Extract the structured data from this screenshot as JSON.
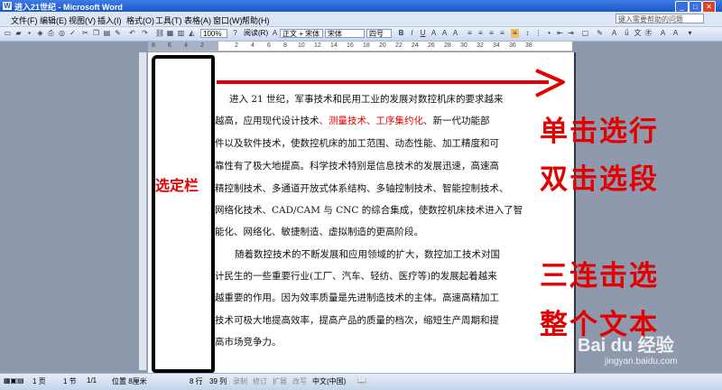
{
  "window": {
    "title": "进入21世纪 - Microsoft Word",
    "min": "_",
    "max": "□",
    "close": "✕"
  },
  "menu": {
    "items": [
      "文件(F)",
      "编辑(E)",
      "视图(V)",
      "插入(I)",
      "格式(O)",
      "工具(T)",
      "表格(A)",
      "窗口(W)",
      "帮助(H)"
    ],
    "help_placeholder": "键入需要帮助的问题"
  },
  "toolbar": {
    "zoom": "100%",
    "read_mode": "阅读(R)",
    "style": "正文 + 宋体",
    "font": "宋体",
    "size": "四号",
    "bold": "B",
    "italic": "I",
    "underline": "U"
  },
  "ruler": {
    "ticks": [
      "8",
      "6",
      "4",
      "2",
      "2",
      "4",
      "6",
      "8",
      "10",
      "12",
      "14",
      "16",
      "18",
      "20",
      "22",
      "24",
      "26",
      "28",
      "30",
      "32",
      "34",
      "36",
      "38"
    ]
  },
  "document": {
    "lines": [
      {
        "pre": "进入 21 世纪，军事技术和民用工业的发展对数控机床的要求越来",
        "red": "",
        "post": ""
      },
      {
        "pre": "越高，应用现代设计技术",
        "red": "、测量技术、工序集约化",
        "post": "、新一代功能部"
      },
      {
        "pre": "件以及软件技术，使数控机床的加工范围、动态性能、加工精度和可",
        "red": "",
        "post": ""
      },
      {
        "pre": "靠性有了极大地提高。科学技术特别是信息技术的发展迅速，高速高",
        "red": "",
        "post": ""
      },
      {
        "pre": "精控制技术、多通道开放式体系结构、多轴控制技术、智能控制技术、",
        "red": "",
        "post": ""
      },
      {
        "pre": "网络化技术、CAD/CAM 与 CNC 的综合集成，使数控机床技术进入了智",
        "red": "",
        "post": ""
      },
      {
        "pre": "能化、网络化、敏捷制造、虚拟制造的更高阶段。",
        "red": "",
        "post": ""
      },
      {
        "pre": "随着数控技术的不断发展和应用领域的扩大，数控加工技术对国",
        "red": "",
        "post": ""
      },
      {
        "pre": "计民生的一些重要行业(工厂、汽车、轻纺、医疗等)的发展起着越来",
        "red": "",
        "post": ""
      },
      {
        "pre": "越重要的作用。因为效率质量是先进制造技术的主体。高速高精加工",
        "red": "",
        "post": ""
      },
      {
        "pre": "技术可极大地提高效率，提高产品的质量的档次，缩短生产周期和提",
        "red": "",
        "post": ""
      },
      {
        "pre": "高市场竞争力。",
        "red": "",
        "post": ""
      }
    ]
  },
  "annotations": {
    "selection_bar": "选定栏",
    "line1": "单击选行",
    "line2": "双击选段",
    "line3": "三连击选",
    "line4": "整个文本"
  },
  "status": {
    "page": "1 页",
    "section": "1 节",
    "pages": "1/1",
    "position": "位置 8厘米",
    "line": "8 行",
    "col": "39 列",
    "rec": "录制",
    "rev": "修订",
    "ext": "扩展",
    "ovr": "改写",
    "lang": "中文(中国)"
  },
  "watermark": {
    "brand": "Bai du 经验",
    "url": "jingyan.baidu.com"
  },
  "colors": {
    "annotation": "#e20000",
    "titlebar": "#1c56c8",
    "page_bg": "#8e99ad"
  }
}
